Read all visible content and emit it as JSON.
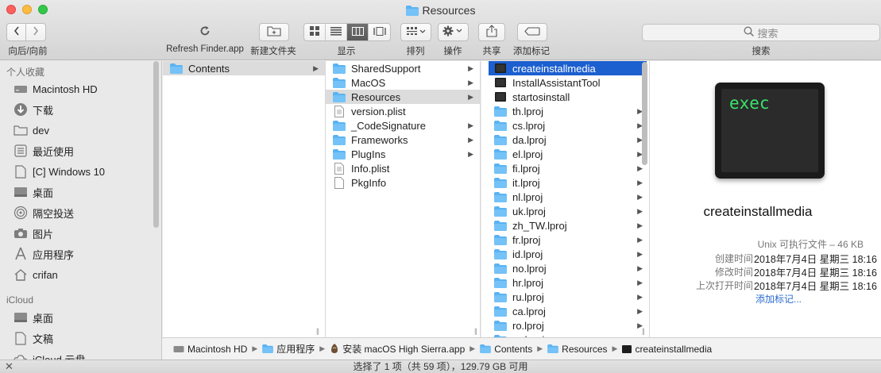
{
  "window": {
    "title": "Resources"
  },
  "toolbar": {
    "back_forward_label": "向后/向前",
    "refresh_label": "Refresh Finder.app",
    "new_folder_label": "新建文件夹",
    "view_label": "显示",
    "arrange_label": "排列",
    "action_label": "操作",
    "share_label": "共享",
    "tags_label": "添加标记",
    "search_placeholder": "搜索",
    "search_label": "搜索"
  },
  "sidebar": {
    "favorites_header": "个人收藏",
    "favorites": [
      {
        "label": "Macintosh HD",
        "icon": "hard-drive-icon"
      },
      {
        "label": "下载",
        "icon": "download-icon"
      },
      {
        "label": "dev",
        "icon": "folder-icon"
      },
      {
        "label": "最近使用",
        "icon": "recents-icon"
      },
      {
        "label": "[C] Windows 10",
        "icon": "document-icon"
      },
      {
        "label": "桌面",
        "icon": "desktop-icon"
      },
      {
        "label": "隔空投送",
        "icon": "airdrop-icon"
      },
      {
        "label": "图片",
        "icon": "camera-icon"
      },
      {
        "label": "应用程序",
        "icon": "applications-icon"
      },
      {
        "label": "crifan",
        "icon": "home-icon"
      }
    ],
    "icloud_header": "iCloud",
    "icloud": [
      {
        "label": "桌面",
        "icon": "desktop-icon"
      },
      {
        "label": "文稿",
        "icon": "document-icon"
      },
      {
        "label": "iCloud 云盘",
        "icon": "cloud-icon"
      }
    ]
  },
  "columns": {
    "col1": [
      {
        "label": "Contents",
        "type": "folder",
        "arrow": true,
        "selected": "gray"
      }
    ],
    "col2": [
      {
        "label": "SharedSupport",
        "type": "folder",
        "arrow": true
      },
      {
        "label": "MacOS",
        "type": "folder",
        "arrow": true
      },
      {
        "label": "Resources",
        "type": "folder",
        "arrow": true,
        "selected": "gray"
      },
      {
        "label": "version.plist",
        "type": "plist",
        "arrow": false
      },
      {
        "label": "_CodeSignature",
        "type": "folder",
        "arrow": true
      },
      {
        "label": "Frameworks",
        "type": "folder",
        "arrow": true
      },
      {
        "label": "PlugIns",
        "type": "folder",
        "arrow": true
      },
      {
        "label": "Info.plist",
        "type": "plist",
        "arrow": false
      },
      {
        "label": "PkgInfo",
        "type": "doc",
        "arrow": false
      }
    ],
    "col3": [
      {
        "label": "createinstallmedia",
        "type": "exec",
        "arrow": false,
        "selected": "blue"
      },
      {
        "label": "InstallAssistantTool",
        "type": "exec",
        "arrow": false
      },
      {
        "label": "startosinstall",
        "type": "exec",
        "arrow": false
      },
      {
        "label": "th.lproj",
        "type": "folder",
        "arrow": true
      },
      {
        "label": "cs.lproj",
        "type": "folder",
        "arrow": true
      },
      {
        "label": "da.lproj",
        "type": "folder",
        "arrow": true
      },
      {
        "label": "el.lproj",
        "type": "folder",
        "arrow": true
      },
      {
        "label": "fi.lproj",
        "type": "folder",
        "arrow": true
      },
      {
        "label": "it.lproj",
        "type": "folder",
        "arrow": true
      },
      {
        "label": "nl.lproj",
        "type": "folder",
        "arrow": true
      },
      {
        "label": "uk.lproj",
        "type": "folder",
        "arrow": true
      },
      {
        "label": "zh_TW.lproj",
        "type": "folder",
        "arrow": true
      },
      {
        "label": "fr.lproj",
        "type": "folder",
        "arrow": true
      },
      {
        "label": "id.lproj",
        "type": "folder",
        "arrow": true
      },
      {
        "label": "no.lproj",
        "type": "folder",
        "arrow": true
      },
      {
        "label": "hr.lproj",
        "type": "folder",
        "arrow": true
      },
      {
        "label": "ru.lproj",
        "type": "folder",
        "arrow": true
      },
      {
        "label": "ca.lproj",
        "type": "folder",
        "arrow": true
      },
      {
        "label": "ro.lproj",
        "type": "folder",
        "arrow": true
      },
      {
        "label": "sv.lproj",
        "type": "folder",
        "arrow": true
      }
    ]
  },
  "preview": {
    "icon_text": "exec",
    "name": "createinstallmedia",
    "kind": "Unix 可执行文件 – 46 KB",
    "created_key": "创建时间",
    "created_val": "2018年7月4日 星期三 18:16",
    "modified_key": "修改时间",
    "modified_val": "2018年7月4日 星期三 18:16",
    "opened_key": "上次打开时间",
    "opened_val": "2018年7月4日 星期三 18:16",
    "add_tags": "添加标记..."
  },
  "pathbar": [
    {
      "label": "Macintosh HD",
      "icon": "hard-drive-icon"
    },
    {
      "label": "应用程序",
      "icon": "folder-icon"
    },
    {
      "label": "安装 macOS High Sierra.app",
      "icon": "installer-icon"
    },
    {
      "label": "Contents",
      "icon": "folder-icon"
    },
    {
      "label": "Resources",
      "icon": "folder-icon"
    },
    {
      "label": "createinstallmedia",
      "icon": "exec-icon"
    }
  ],
  "status": {
    "text": "选择了 1 项（共 59 项），129.79 GB 可用"
  },
  "colors": {
    "selection_blue": "#1c5fcf",
    "folder_blue": "#5ab3f2",
    "exec_green": "#39e36b"
  }
}
